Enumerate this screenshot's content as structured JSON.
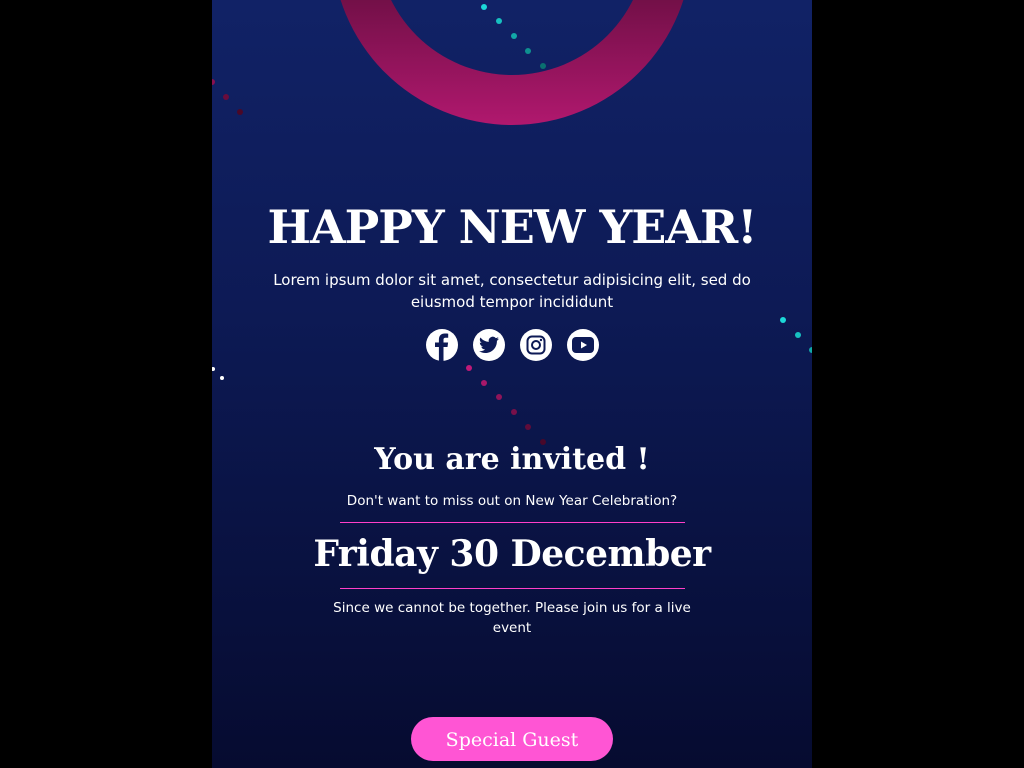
{
  "hero": {
    "title": "HAPPY NEW YEAR!",
    "lead": "Lorem ipsum dolor sit amet, consectetur adipisicing elit, sed do eiusmod tempor incididunt"
  },
  "social": [
    {
      "icon": "facebook-icon"
    },
    {
      "icon": "twitter-icon"
    },
    {
      "icon": "instagram-icon"
    },
    {
      "icon": "youtube-icon"
    }
  ],
  "invite": {
    "heading": "You are invited !",
    "subtitle": "Don't want to miss out on New Year Celebration?",
    "date": "Friday 30 December",
    "note": "Since we cannot be together. Please join us for a live event"
  },
  "cta": {
    "label": "Special Guest"
  },
  "colors": {
    "accent": "#ff55d4",
    "divider": "#ff3fc8",
    "background": "#0d1a55"
  }
}
